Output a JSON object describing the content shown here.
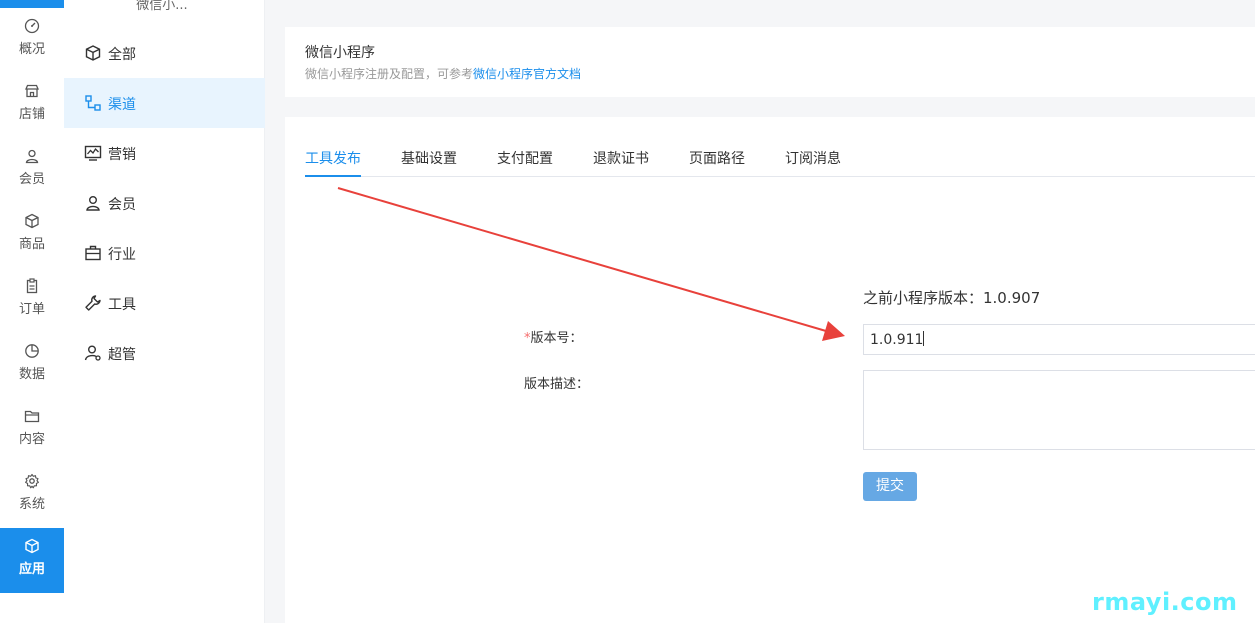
{
  "rail": {
    "items": [
      {
        "label": "概况",
        "icon": "gauge-icon"
      },
      {
        "label": "店铺",
        "icon": "store-icon"
      },
      {
        "label": "会员",
        "icon": "user-icon"
      },
      {
        "label": "商品",
        "icon": "box-icon"
      },
      {
        "label": "订单",
        "icon": "clipboard-icon"
      },
      {
        "label": "数据",
        "icon": "pie-chart-icon"
      },
      {
        "label": "内容",
        "icon": "folder-icon"
      },
      {
        "label": "系统",
        "icon": "gear-icon"
      },
      {
        "label": "应用",
        "icon": "cube-icon",
        "active": true
      }
    ],
    "accent": "#1b8eeb"
  },
  "menu": {
    "header": "微信小...",
    "items": [
      {
        "label": "全部",
        "icon": "cube-icon"
      },
      {
        "label": "渠道",
        "icon": "channel-icon",
        "active": true
      },
      {
        "label": "营销",
        "icon": "trend-chart-icon"
      },
      {
        "label": "会员",
        "icon": "user-icon"
      },
      {
        "label": "行业",
        "icon": "briefcase-icon"
      },
      {
        "label": "工具",
        "icon": "wrench-icon"
      },
      {
        "label": "超管",
        "icon": "admin-user-icon"
      }
    ]
  },
  "header": {
    "title": "微信小程序",
    "subtitle_prefix": "微信小程序注册及配置，可参考",
    "doc_link": "微信小程序官方文档"
  },
  "tabs": [
    {
      "label": "工具发布",
      "active": true
    },
    {
      "label": "基础设置"
    },
    {
      "label": "支付配置"
    },
    {
      "label": "退款证书"
    },
    {
      "label": "页面路径"
    },
    {
      "label": "订阅消息"
    }
  ],
  "form": {
    "previous_version_text": "之前小程序版本：1.0.907",
    "version_required_mark": "*",
    "version_label": "版本号：",
    "version_value": "1.0.911",
    "description_label": "版本描述：",
    "description_value": "",
    "submit_label": "提交"
  },
  "watermark": "rmayi.com"
}
